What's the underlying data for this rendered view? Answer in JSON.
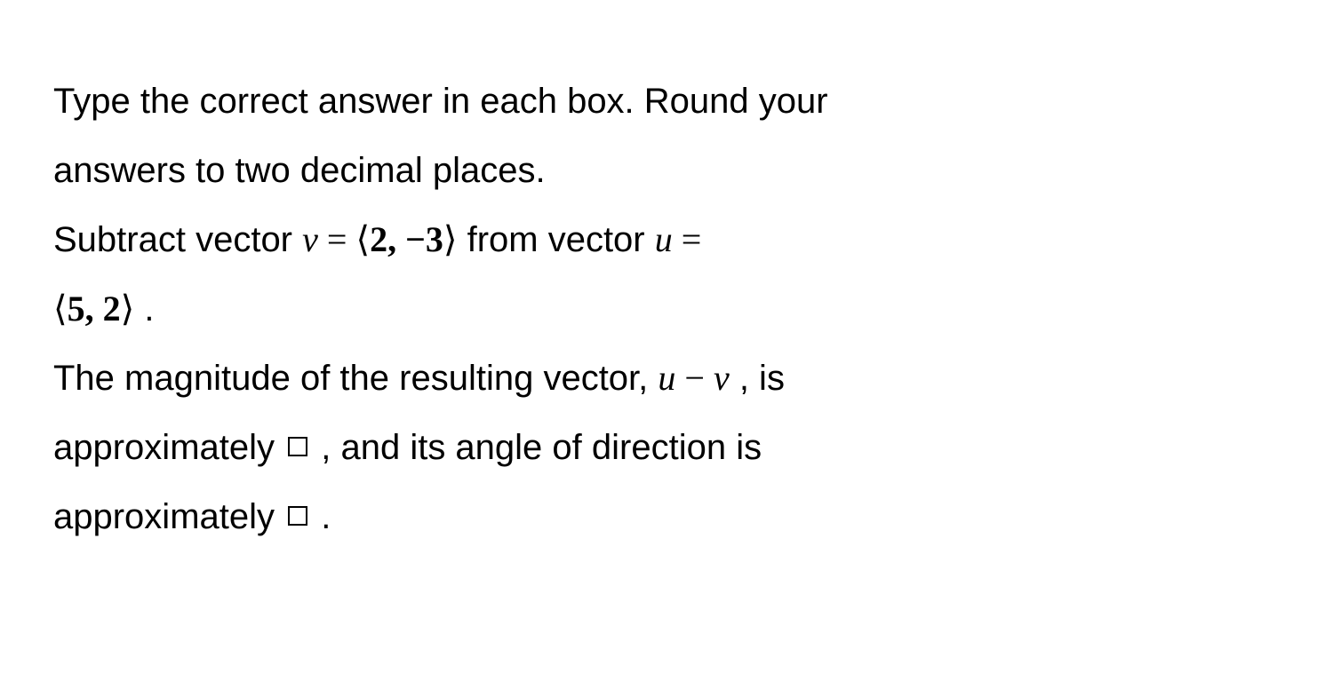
{
  "text": {
    "line1_a": "Type the correct answer in each box. Round your",
    "line2_a": "answers to two decimal places.",
    "line3_a": "Subtract vector ",
    "math_v": "v",
    "math_eq1": " = ",
    "math_lang1": "⟨",
    "math_vec_v": "2, −3",
    "math_rang1": "⟩",
    "line3_b": "  from vector ",
    "math_u": "u",
    "math_eq2": " =",
    "math_lang2": "⟨",
    "math_vec_u": "5, 2",
    "math_rang2": "⟩",
    "period1": " .",
    "line5_a": "The magnitude of the resulting vector, ",
    "math_uminusv_u": "u",
    "math_minus": " − ",
    "math_uminusv_v": "v",
    "line5_b": " , is",
    "line6_a": "approximately ",
    "line6_b": " , and its angle of direction is",
    "line7_a": "approximately ",
    "period2": " ."
  }
}
